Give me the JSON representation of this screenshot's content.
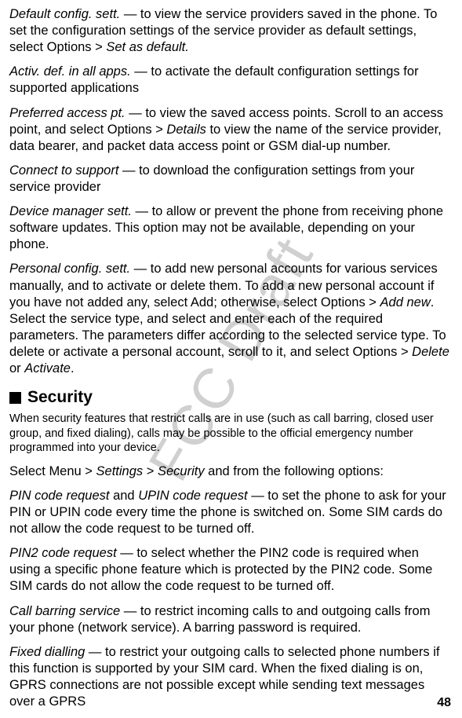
{
  "watermark": "FCC Draft",
  "paragraphs": {
    "p1_i": "Default config. sett.",
    "p1_r": " — to view the service providers saved in the phone. To set the configuration settings of the service provider as default settings, select Options > ",
    "p1_i2": "Set as default.",
    "p2_i": "Activ. def. in all apps.",
    "p2_r": " — to activate the default configuration settings for supported applications",
    "p3_i": "Preferred access pt.",
    "p3_r": " — to view the saved access points. Scroll to an access point, and select Options > ",
    "p3_i2": "Details",
    "p3_r2": " to view the name of the service provider, data bearer, and packet data access point or GSM dial-up number.",
    "p4_i": "Connect to support",
    "p4_r": " — to download the configuration settings from your service provider",
    "p5_i": "Device manager sett.",
    "p5_r": " — to allow or prevent the phone from receiving phone software updates. This option may not be available, depending on your phone.",
    "p6_i": "Personal config. sett.",
    "p6_r": " — to add new personal accounts for various services manually, and to activate or delete them. To add a new personal account if you have not added any, select Add; otherwise, select Options > ",
    "p6_i2": "Add new",
    "p6_r2": ". Select the service type, and select and enter each of the required parameters. The parameters differ according to the selected service type. To delete or activate a personal account, scroll to it, and select Options > ",
    "p6_i3": "Delete",
    "p6_r3": " or ",
    "p6_i4": "Activate",
    "p6_r4": "."
  },
  "heading": "Security",
  "security": {
    "s1": "When security features that restrict calls are in use (such as call barring, closed user group, and fixed dialing), calls may be possible to the official emergency number programmed into your device.",
    "s2_r1": "Select Menu > ",
    "s2_i1": "Settings",
    "s2_r2": " > ",
    "s2_i2": "Security",
    "s2_r3": " and from the following options:",
    "s3_i1": "PIN code request",
    "s3_r1": " and ",
    "s3_i2": "UPIN code request",
    "s3_r2": " — to set the phone to ask for your PIN or UPIN code every time the phone is switched on. Some SIM cards do not allow the code request to be turned off.",
    "s4_i": "PIN2 code request",
    "s4_r": " — to select whether the PIN2 code is required when using a specific phone feature which is protected by the PIN2 code. Some SIM cards do not allow the code request to be turned off.",
    "s5_i": "Call barring service",
    "s5_r": " — to restrict incoming calls to and outgoing calls from your phone (network service). A barring password is required.",
    "s6_i": "Fixed dialling",
    "s6_r": " — to restrict your outgoing calls to selected phone numbers if this function is supported by your SIM card. When the fixed dialing is on, GPRS connections are not possible except while sending text messages over a GPRS"
  },
  "page_number": "48"
}
